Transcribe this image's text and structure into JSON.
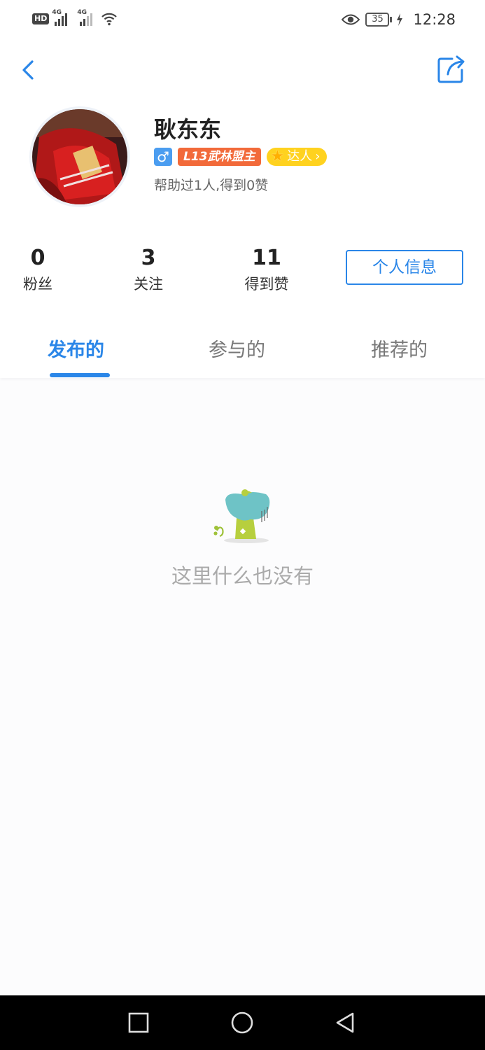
{
  "status_bar": {
    "left_badge": "HD",
    "net1": "4G",
    "net2": "4G",
    "battery": "35",
    "time": "12:28"
  },
  "profile": {
    "name": "耿东东",
    "gender_symbol": "♂",
    "level_badge": "L13武林盟主",
    "expert_badge": "达人",
    "helped_text": "帮助过1人,得到0赞"
  },
  "stats": [
    {
      "value": "0",
      "label": "粉丝"
    },
    {
      "value": "3",
      "label": "关注"
    },
    {
      "value": "11",
      "label": "得到赞"
    }
  ],
  "info_button": "个人信息",
  "tabs": [
    {
      "label": "发布的",
      "active": true
    },
    {
      "label": "参与的",
      "active": false
    },
    {
      "label": "推荐的",
      "active": false
    }
  ],
  "empty_state": {
    "text": "这里什么也没有"
  },
  "colors": {
    "accent": "#2a86e8",
    "level_badge": "#f26a3a",
    "expert_badge": "#ffd21f",
    "gender_badge": "#4b9df0"
  },
  "icons": {
    "back": "chevron-left-icon",
    "share": "share-icon",
    "nav": [
      "square-icon",
      "circle-icon",
      "triangle-back-icon"
    ]
  }
}
